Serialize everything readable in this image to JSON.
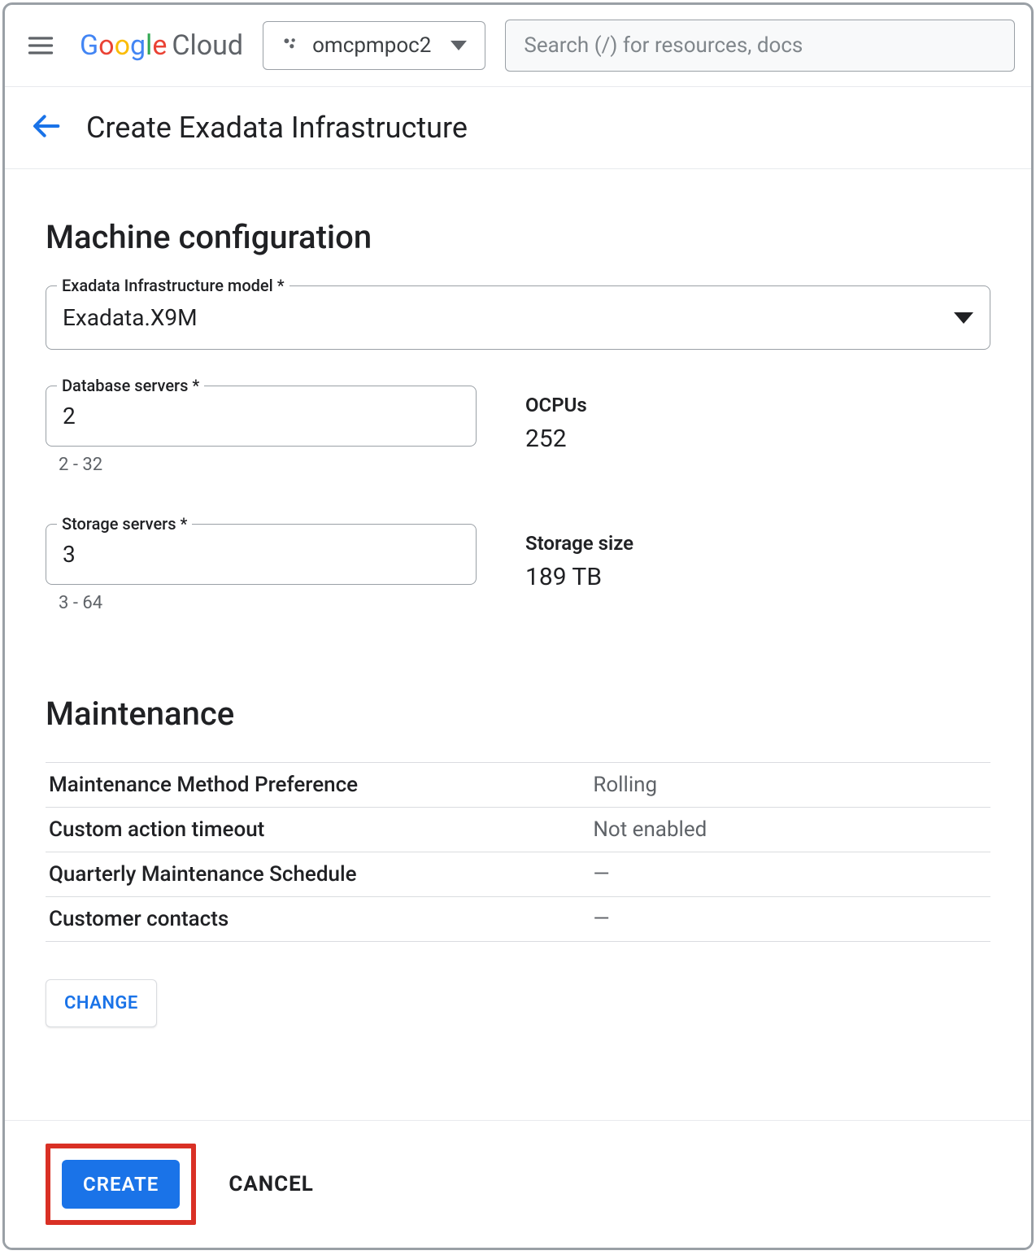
{
  "header": {
    "logo_google": "Google",
    "logo_cloud": "Cloud",
    "project": "omcpmpoc2",
    "search_placeholder": "Search (/) for resources, docs"
  },
  "page": {
    "title": "Create Exadata Infrastructure"
  },
  "machine": {
    "title": "Machine configuration",
    "model_label": "Exadata Infrastructure model *",
    "model_value": "Exadata.X9M",
    "db_servers_label": "Database servers *",
    "db_servers_value": "2",
    "db_servers_helper": "2 - 32",
    "ocpus_label": "OCPUs",
    "ocpus_value": "252",
    "storage_servers_label": "Storage servers *",
    "storage_servers_value": "3",
    "storage_servers_helper": "3 - 64",
    "storage_size_label": "Storage size",
    "storage_size_value": "189 TB"
  },
  "maintenance": {
    "title": "Maintenance",
    "rows": [
      {
        "k": "Maintenance Method Preference",
        "v": "Rolling"
      },
      {
        "k": "Custom action timeout",
        "v": "Not enabled"
      },
      {
        "k": "Quarterly Maintenance Schedule",
        "v": "—"
      },
      {
        "k": "Customer contacts",
        "v": "—"
      }
    ],
    "change_label": "CHANGE"
  },
  "footer": {
    "create_label": "CREATE",
    "cancel_label": "CANCEL"
  }
}
